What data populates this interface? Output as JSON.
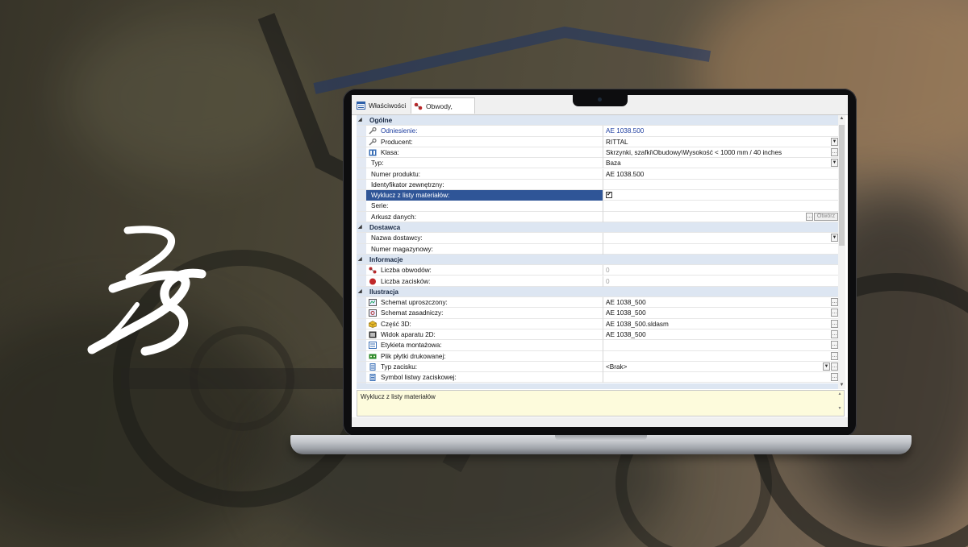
{
  "tabs": [
    {
      "label": "Właściwości",
      "icon": "properties-icon"
    },
    {
      "label": "Obwody, zaciski",
      "icon": "circuit-icon"
    }
  ],
  "properties": {
    "general": {
      "title": "Ogólne",
      "rows": [
        {
          "label": "Odniesienie:",
          "value": "AE 1038.500",
          "icon": "wrench-icon"
        },
        {
          "label": "Producent:",
          "value": "RITTAL",
          "icon": "wrench-icon"
        },
        {
          "label": "Klasa:",
          "value": "Skrzynki, szafki\\Obudowy\\Wysokość < 1000 mm / 40 inches",
          "icon": "class-icon"
        },
        {
          "label": "Typ:",
          "value": "Baza"
        },
        {
          "label": "Numer produktu:",
          "value": "AE 1038.500"
        },
        {
          "label": "Identyfikator zewnętrzny:",
          "value": ""
        },
        {
          "label": "Wyklucz z listy materiałów:",
          "value": "✔",
          "checked": true
        },
        {
          "label": "Serie:",
          "value": ""
        },
        {
          "label": "Arkusz danych:",
          "value": "",
          "open_label": "Otwórz"
        }
      ]
    },
    "supplier": {
      "title": "Dostawca",
      "rows": [
        {
          "label": "Nazwa dostawcy:",
          "value": ""
        },
        {
          "label": "Numer magazynowy:",
          "value": ""
        }
      ]
    },
    "information": {
      "title": "Informacje",
      "rows": [
        {
          "label": "Liczba obwodów:",
          "value": "0",
          "icon": "circuits-icon"
        },
        {
          "label": "Liczba zacisków:",
          "value": "0",
          "icon": "terminal-dot-icon"
        }
      ]
    },
    "illustration": {
      "title": "Ilustracja",
      "rows": [
        {
          "label": "Schemat uproszczony:",
          "value": "AE 1038_500",
          "icon": "schematic-icon"
        },
        {
          "label": "Schemat zasadniczy:",
          "value": "AE 1038_500",
          "icon": "schematic-icon"
        },
        {
          "label": "Część 3D:",
          "value": "AE 1038_500.sldasm",
          "icon": "part-3d-icon"
        },
        {
          "label": "Widok aparatu 2D:",
          "value": "AE 1038_500",
          "icon": "view-2d-icon"
        },
        {
          "label": "Etykieta montażowa:",
          "value": "",
          "icon": "label-icon"
        },
        {
          "label": "Plik płytki drukowanej:",
          "value": "",
          "icon": "pcb-icon"
        },
        {
          "label": "Typ zacisku:",
          "value": "<Brak>",
          "icon": "terminal-type-icon"
        },
        {
          "label": "Symbol listwy zaciskowej:",
          "value": "",
          "icon": "terminal-strip-icon"
        }
      ]
    }
  },
  "description": {
    "text": "Wyklucz z listy materiałów"
  },
  "colors": {
    "selection": "#2f5597",
    "category": "#dde6f2",
    "description_bg": "#fdfbdc",
    "reference_text": "#1f3fa0"
  },
  "logo": {
    "text": "3DS"
  }
}
